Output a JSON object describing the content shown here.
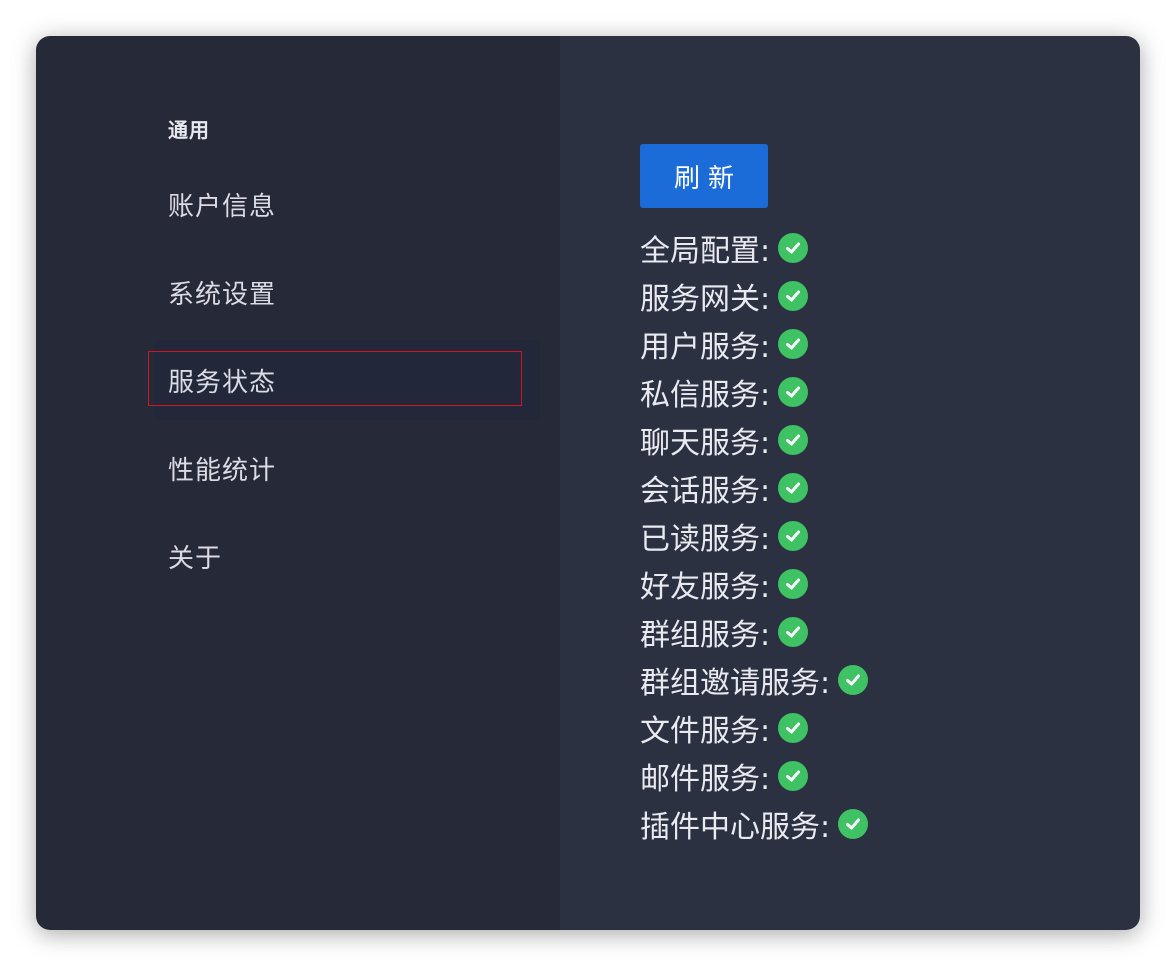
{
  "sidebar": {
    "section_title": "通用",
    "items": [
      {
        "label": "账户信息"
      },
      {
        "label": "系统设置"
      },
      {
        "label": "服务状态"
      },
      {
        "label": "性能统计"
      },
      {
        "label": "关于"
      }
    ]
  },
  "main": {
    "refresh_label": "刷新",
    "services": [
      {
        "label": "全局配置:",
        "status": "ok"
      },
      {
        "label": "服务网关:",
        "status": "ok"
      },
      {
        "label": "用户服务:",
        "status": "ok"
      },
      {
        "label": "私信服务:",
        "status": "ok"
      },
      {
        "label": "聊天服务:",
        "status": "ok"
      },
      {
        "label": "会话服务:",
        "status": "ok"
      },
      {
        "label": "已读服务:",
        "status": "ok"
      },
      {
        "label": "好友服务:",
        "status": "ok"
      },
      {
        "label": "群组服务:",
        "status": "ok"
      },
      {
        "label": "群组邀请服务:",
        "status": "ok"
      },
      {
        "label": "文件服务:",
        "status": "ok"
      },
      {
        "label": "邮件服务:",
        "status": "ok"
      },
      {
        "label": "插件中心服务:",
        "status": "ok"
      }
    ],
    "status_icon": "check-circle-icon"
  },
  "colors": {
    "sidebar_bg": "#262a38",
    "content_bg": "#2c3142",
    "accent": "#1b6bd8",
    "ok": "#3fc263",
    "highlight": "#d0161e"
  }
}
